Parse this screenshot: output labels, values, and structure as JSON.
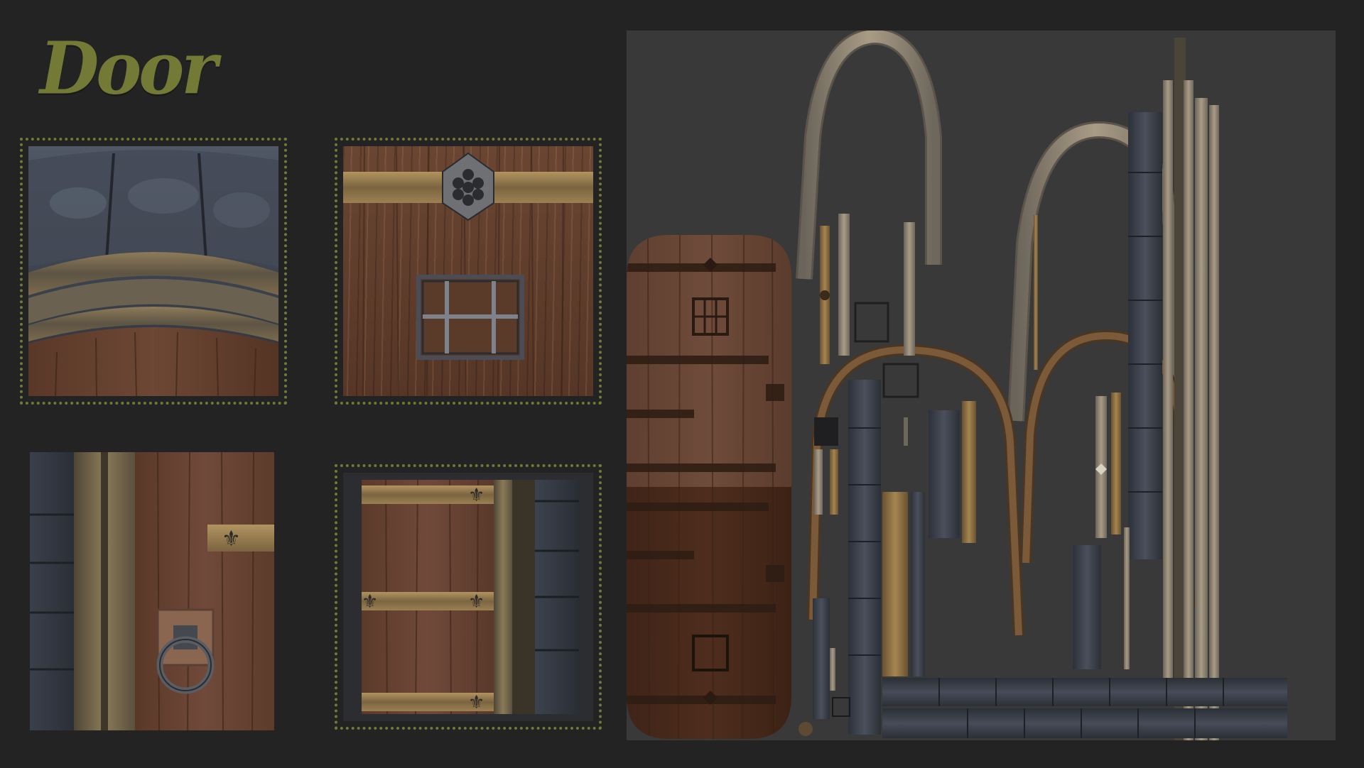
{
  "title": "Door",
  "colors": {
    "background": "#232323",
    "title": "#737a35",
    "frame_dots": "#6f7a36",
    "uv_background": "#393939"
  },
  "panels": [
    {
      "name": "arch-detail"
    },
    {
      "name": "window-grate-detail"
    },
    {
      "name": "ring-handle-detail"
    },
    {
      "name": "fleur-hinge-detail"
    }
  ]
}
